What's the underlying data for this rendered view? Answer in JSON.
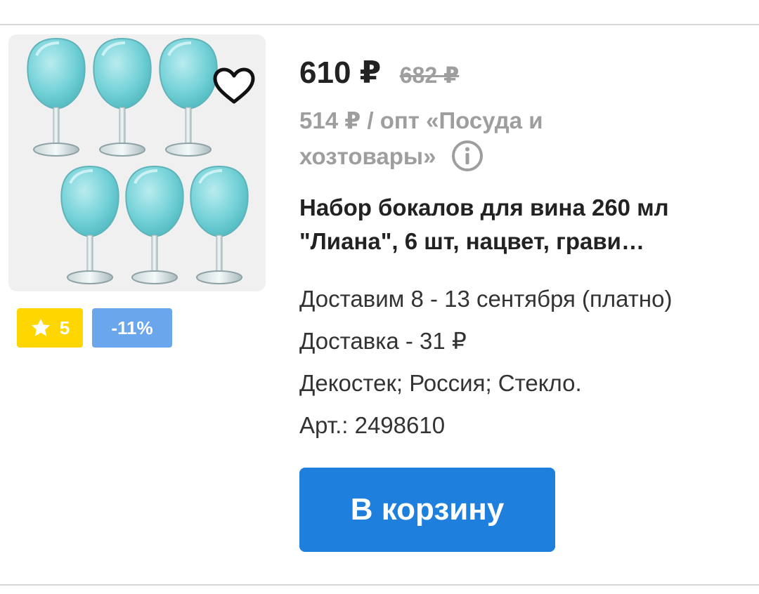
{
  "product": {
    "price": "610 ₽",
    "old_price": "682 ₽",
    "wholesale_text": "514 ₽ / опт «Посуда и хозтовары»",
    "title": "Набор бокалов для вина 260 мл \"Лиана\", 6 шт, нацвет, грави…",
    "delivery_dates": "Доставим 8 - 13 сентября (платно)",
    "delivery_cost": "Доставка - 31 ₽",
    "attributes": "Декостек; Россия; Стекло.",
    "article": "Арт.: 2498610",
    "rating": "5",
    "discount": "-11%",
    "cart_button_label": "В корзину",
    "image_icon": "wine-glasses-set",
    "favorite_icon": "heart-outline-icon",
    "info_icon": "info-circle-icon"
  },
  "colors": {
    "accent_button": "#1e7fdc",
    "rating_badge": "#ffd600",
    "discount_badge": "#6aa6ec",
    "muted_text": "#9e9e9e"
  }
}
